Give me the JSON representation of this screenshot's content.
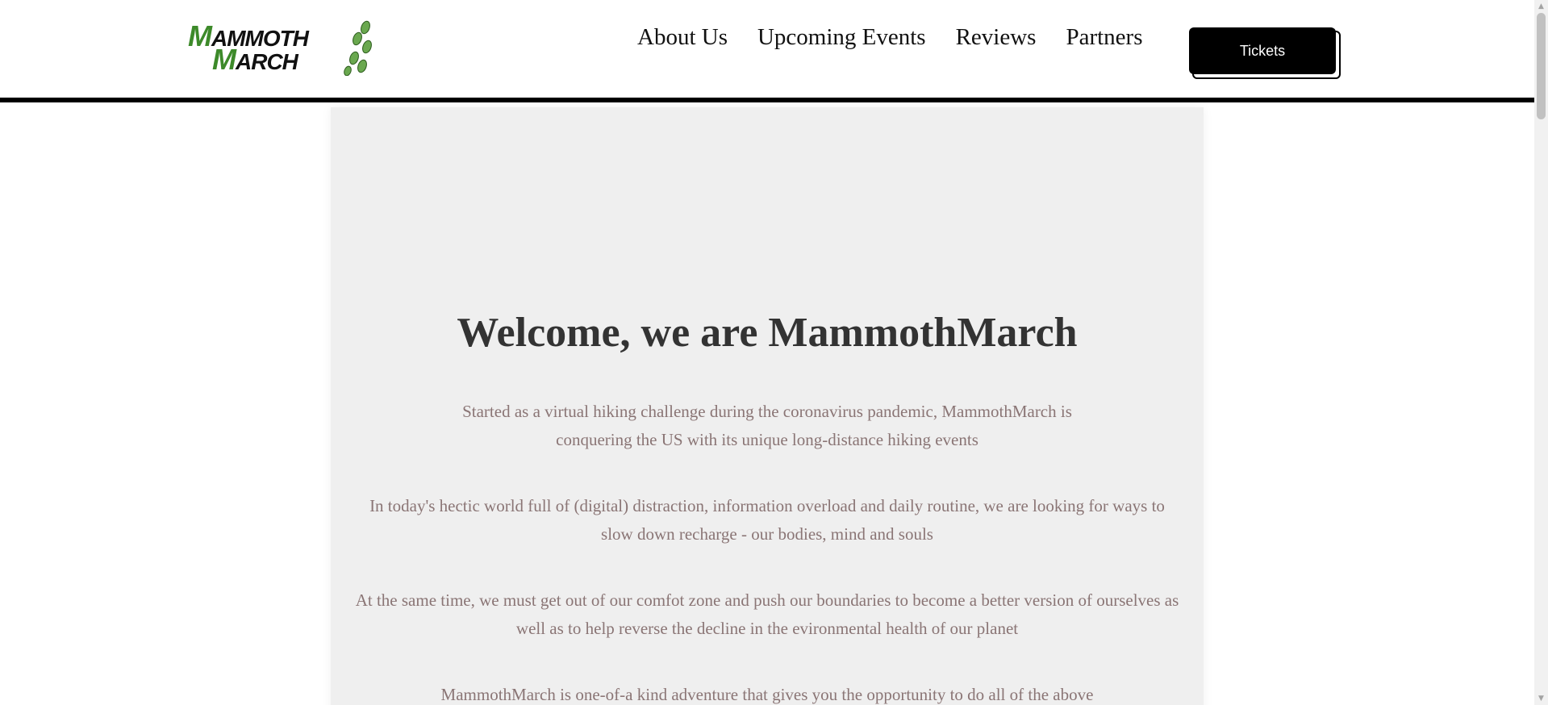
{
  "header": {
    "logo": {
      "line1_initial": "M",
      "line1_rest": "AMMOTH",
      "line2_initial": "M",
      "line2_rest": "ARCH"
    },
    "nav": [
      {
        "label": "About Us"
      },
      {
        "label": "Upcoming Events"
      },
      {
        "label": "Reviews"
      },
      {
        "label": "Partners"
      }
    ],
    "tickets_label": "Tickets"
  },
  "main": {
    "title": "Welcome, we are MammothMarch",
    "paragraphs": [
      "Started as a virtual hiking challenge during the coronavirus pandemic, MammothMarch is conquering the US with its unique long-distance hiking events",
      "In today's hectic world full of (digital) distraction, information overload and daily routine, we are looking for ways to slow down recharge - our bodies, mind and souls",
      "At the same time, we must get out of our comfot zone and push our boundaries to become a better version of ourselves as well as to help reverse the decline in the evironmental health of our planet",
      "MammothMarch is one-of-a kind adventure that gives you the opportunity to do all of the above"
    ]
  },
  "colors": {
    "brand_green": "#3d8a2a",
    "text_dark": "#333333",
    "text_muted": "#8a7575",
    "panel_bg": "#efefef"
  },
  "icons": {
    "logo_mark": "footprints-icon",
    "scroll_up": "scroll-up-arrow-icon",
    "scroll_down": "scroll-down-arrow-icon"
  }
}
